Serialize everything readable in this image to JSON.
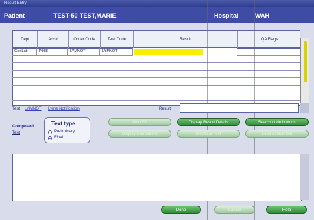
{
  "window": {
    "title": "Result Entry"
  },
  "header": {
    "patient_label": "Patient",
    "patient_name": "TEST-50 TEST,MARIE",
    "hospital_label": "Hospital",
    "hospital_value": "WAH"
  },
  "grid": {
    "columns": [
      "Dept",
      "Acc#",
      "Order Code",
      "Test Code",
      "Result",
      "QA Flags"
    ],
    "rows": [
      [
        "GenLab",
        "P988",
        "LYMNOT",
        "LYMNOT",
        "",
        ""
      ]
    ]
  },
  "test_section": {
    "test_label": "Test",
    "test_code": "LYMNOT",
    "test_name": "Lyme Notification",
    "result_label": "Result"
  },
  "composed": {
    "label_line1": "Composed",
    "label_line2": "Text",
    "type_title": "Text type",
    "preliminary": "Preliminary",
    "final": "Final",
    "selected": "Final"
  },
  "buttons": {
    "auto_fill": "Auto Fill",
    "display_result_details": "Display Result Details",
    "search_code_buttons": "Search code buttons",
    "display_corrections": "Display Corrections",
    "delete_all_text": "Delete all text",
    "load_default_text": "Load default text",
    "done": "Done",
    "cancel": "Cancel",
    "help": "Help"
  },
  "colors": {
    "header": "#3e4ca6",
    "highlight": "#f6f000",
    "button_green": "#2f8b37"
  }
}
